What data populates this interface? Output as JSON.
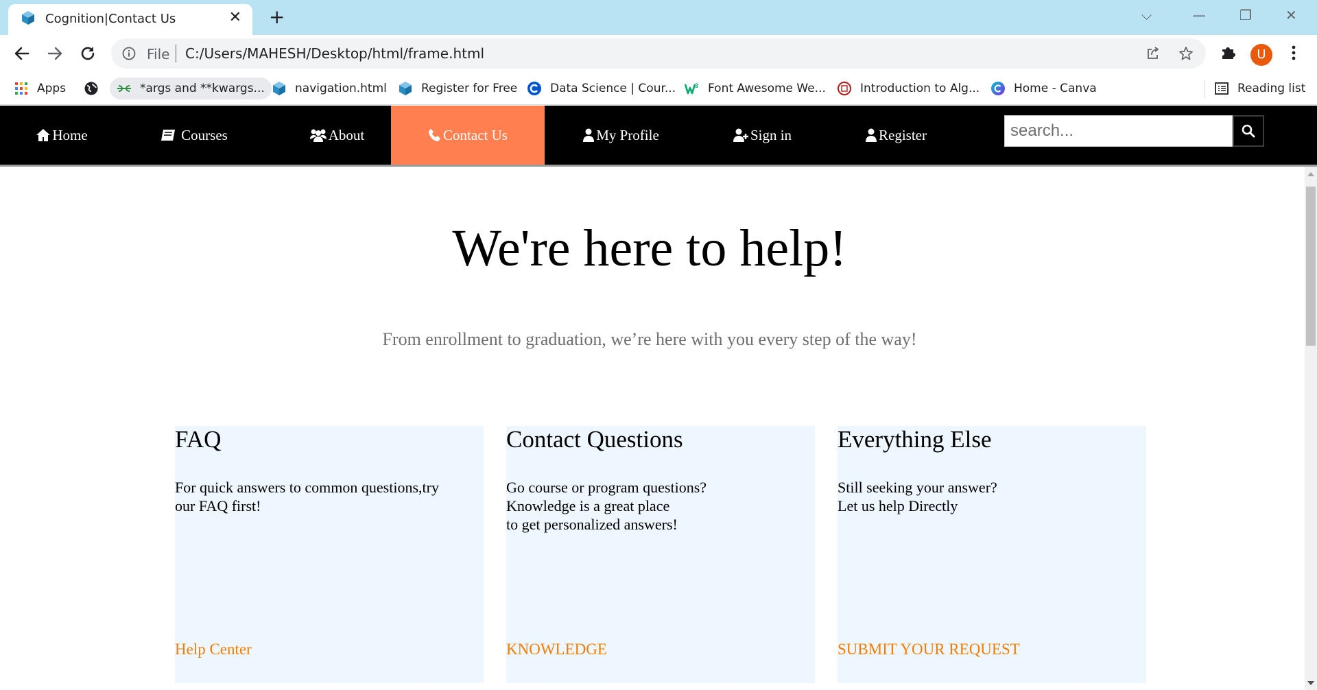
{
  "browser": {
    "tab_title": "Cognition|Contact Us",
    "tab_close": "✕",
    "new_tab": "+",
    "window_controls": {
      "tabsearch": "⌵",
      "minimize": "—",
      "restore": "❐",
      "close": "✕"
    },
    "address": {
      "scheme_label": "File",
      "url": "C:/Users/MAHESH/Desktop/html/frame.html"
    },
    "profile_initial": "U",
    "bookmarks": [
      {
        "label": "Apps",
        "icon": "apps-grid-icon"
      },
      {
        "label": "",
        "icon": "globe-icon"
      },
      {
        "label": "*args and **kwargs...",
        "icon": "geeksforgeeks-icon"
      },
      {
        "label": "navigation.html",
        "icon": "cube-icon"
      },
      {
        "label": "Register for Free",
        "icon": "cube-icon"
      },
      {
        "label": "Data Science | Cour...",
        "icon": "coursera-icon"
      },
      {
        "label": "Font Awesome We...",
        "icon": "w3schools-icon"
      },
      {
        "label": "Introduction to Alg...",
        "icon": "cornell-icon"
      },
      {
        "label": "Home - Canva",
        "icon": "canva-icon"
      }
    ],
    "reading_list": "Reading list"
  },
  "site_nav": {
    "items": [
      {
        "label": "Home",
        "icon": "home-icon"
      },
      {
        "label": "Courses",
        "icon": "book-icon"
      },
      {
        "label": "About",
        "icon": "users-icon"
      },
      {
        "label": "Contact Us",
        "icon": "phone-icon",
        "active": true
      },
      {
        "label": "My Profile",
        "icon": "user-icon"
      },
      {
        "label": "Sign in",
        "icon": "user-plus-icon"
      },
      {
        "label": "Register",
        "icon": "user-icon"
      }
    ],
    "search_placeholder": "search...",
    "active_color": "#ff7f50"
  },
  "hero": {
    "title": "We're here to help!",
    "subtitle": "From enrollment to graduation, we’re here with you every step of the way!"
  },
  "cards": [
    {
      "title": "FAQ",
      "text": "For quick answers to common questions,try\nour FAQ first!",
      "link": "Help Center"
    },
    {
      "title": "Contact Questions",
      "text": "Go course or program questions?\nKnowledge is a great place\nto get personalized answers!",
      "link": "KNOWLEDGE"
    },
    {
      "title": "Everything Else",
      "text": "Still seeking your answer?\nLet us help Directly",
      "link": "SUBMIT YOUR REQUEST"
    }
  ],
  "colors": {
    "card_bg": "#eef7ff",
    "link": "#f07d00",
    "nav_bg": "#000000",
    "tabstrip": "#b9e3f2"
  }
}
